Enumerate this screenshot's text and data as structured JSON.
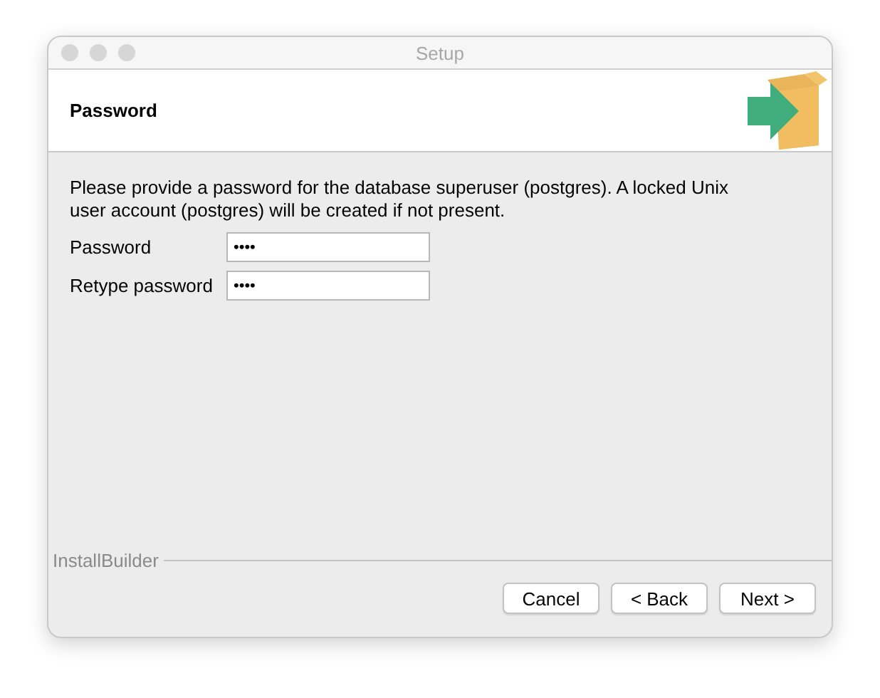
{
  "window": {
    "title": "Setup"
  },
  "header": {
    "title": "Password"
  },
  "description": "Please provide a password for the database superuser (postgres). A locked Unix user account (postgres) will be created if not present.",
  "fields": [
    {
      "label": "Password",
      "value": "••••"
    },
    {
      "label": "Retype password",
      "value": "••••"
    }
  ],
  "footer": {
    "brand": "InstallBuilder"
  },
  "buttons": [
    "Cancel",
    "< Back",
    "Next >"
  ]
}
